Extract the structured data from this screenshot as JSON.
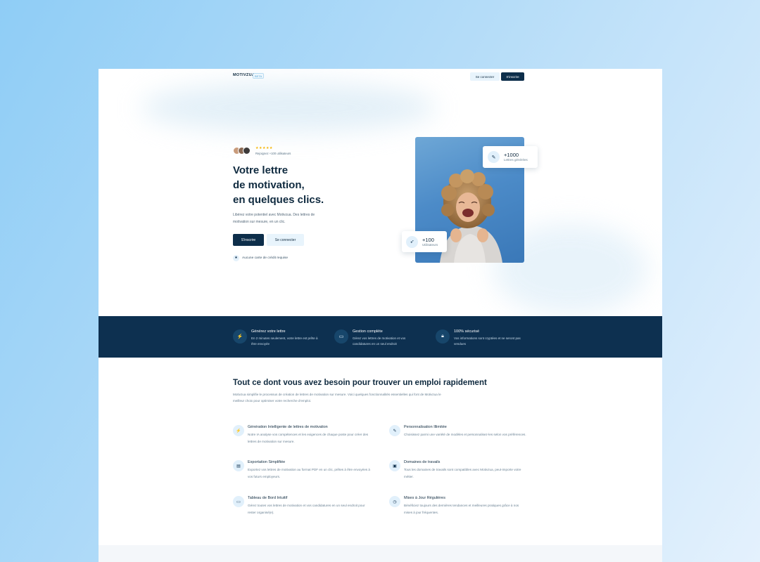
{
  "header": {
    "logo": "MOTIVZUA",
    "logo_badge": "BETA",
    "login_label": "Se connecter",
    "signup_label": "S'inscrire"
  },
  "hero": {
    "stars": "★★★★★",
    "rating_text": "Rejoignez +100 utilisateurs",
    "title_lines": [
      "Votre lettre",
      "de motivation,",
      "en quelques clics."
    ],
    "subtitle": "Libérez votre potentiel avec Motivzua. Des lettres de motivation sur mesure, en un clic.",
    "signup_label": "S'inscrire",
    "login_label": "Se connecter",
    "no_card_text": "Aucune carte de crédit requise",
    "stat_letters": {
      "value": "+1000",
      "label": "Lettres générées",
      "icon": "pencil-icon"
    },
    "stat_users": {
      "value": "+100",
      "label": "Utilisateurs",
      "icon": "rocket-icon"
    }
  },
  "band": [
    {
      "title": "Générez votre lettre",
      "desc": "En 2 minutes seulement, votre lettre est prête à être envoyée",
      "icon": "bolt-icon"
    },
    {
      "title": "Gestion complète",
      "desc": "Gérez vos lettres de motivation et vos candidatures en un seul endroit",
      "icon": "monitor-icon"
    },
    {
      "title": "100% sécurisé",
      "desc": "Vos informations sont cryptées et ne seront pas vendues",
      "icon": "lock-icon"
    }
  ],
  "features": {
    "title": "Tout ce dont vous avez besoin pour trouver un emploi rapidement",
    "intro": "Motivzua simplifie le processus de création de lettres de motivation sur mesure. Voici quelques fonctionnalités essentielles qui font de Motivzua le meilleur choix pour optimiser votre recherche d'emploi.",
    "items": [
      {
        "name": "Génération Intelligente de lettres de motivation",
        "desc": "Notre IA analyse vos compétences et les exigences de chaque poste pour créer des lettres de motivation sur mesure.",
        "icon": "bolt-icon"
      },
      {
        "name": "Personnalisation Illimitée",
        "desc": "Choisissez parmi une variété de modèles et personnalisez-les selon vos préférences.",
        "icon": "pencil-icon"
      },
      {
        "name": "Exportation Simplifiée",
        "desc": "Exportez vos lettres de motivation au format PDF en un clic, prêtes à être envoyées à vos futurs employeurs.",
        "icon": "document-icon"
      },
      {
        "name": "Domaines de travails",
        "desc": "Tous les domaines de travails sont compatibles avec Motivzua, peut-importe votre métier.",
        "icon": "briefcase-icon"
      },
      {
        "name": "Tableau de Bord Intuitif",
        "desc": "Gérez toutes vos lettres de motivation et vos candidatures en un seul endroit pour rester organisé(e).",
        "icon": "monitor-icon"
      },
      {
        "name": "Mises à Jour Régulières",
        "desc": "Bénéficiez toujours des dernières tendances et meilleures pratiques grâce à nos mises à jour fréquentes.",
        "icon": "clock-icon"
      }
    ]
  }
}
